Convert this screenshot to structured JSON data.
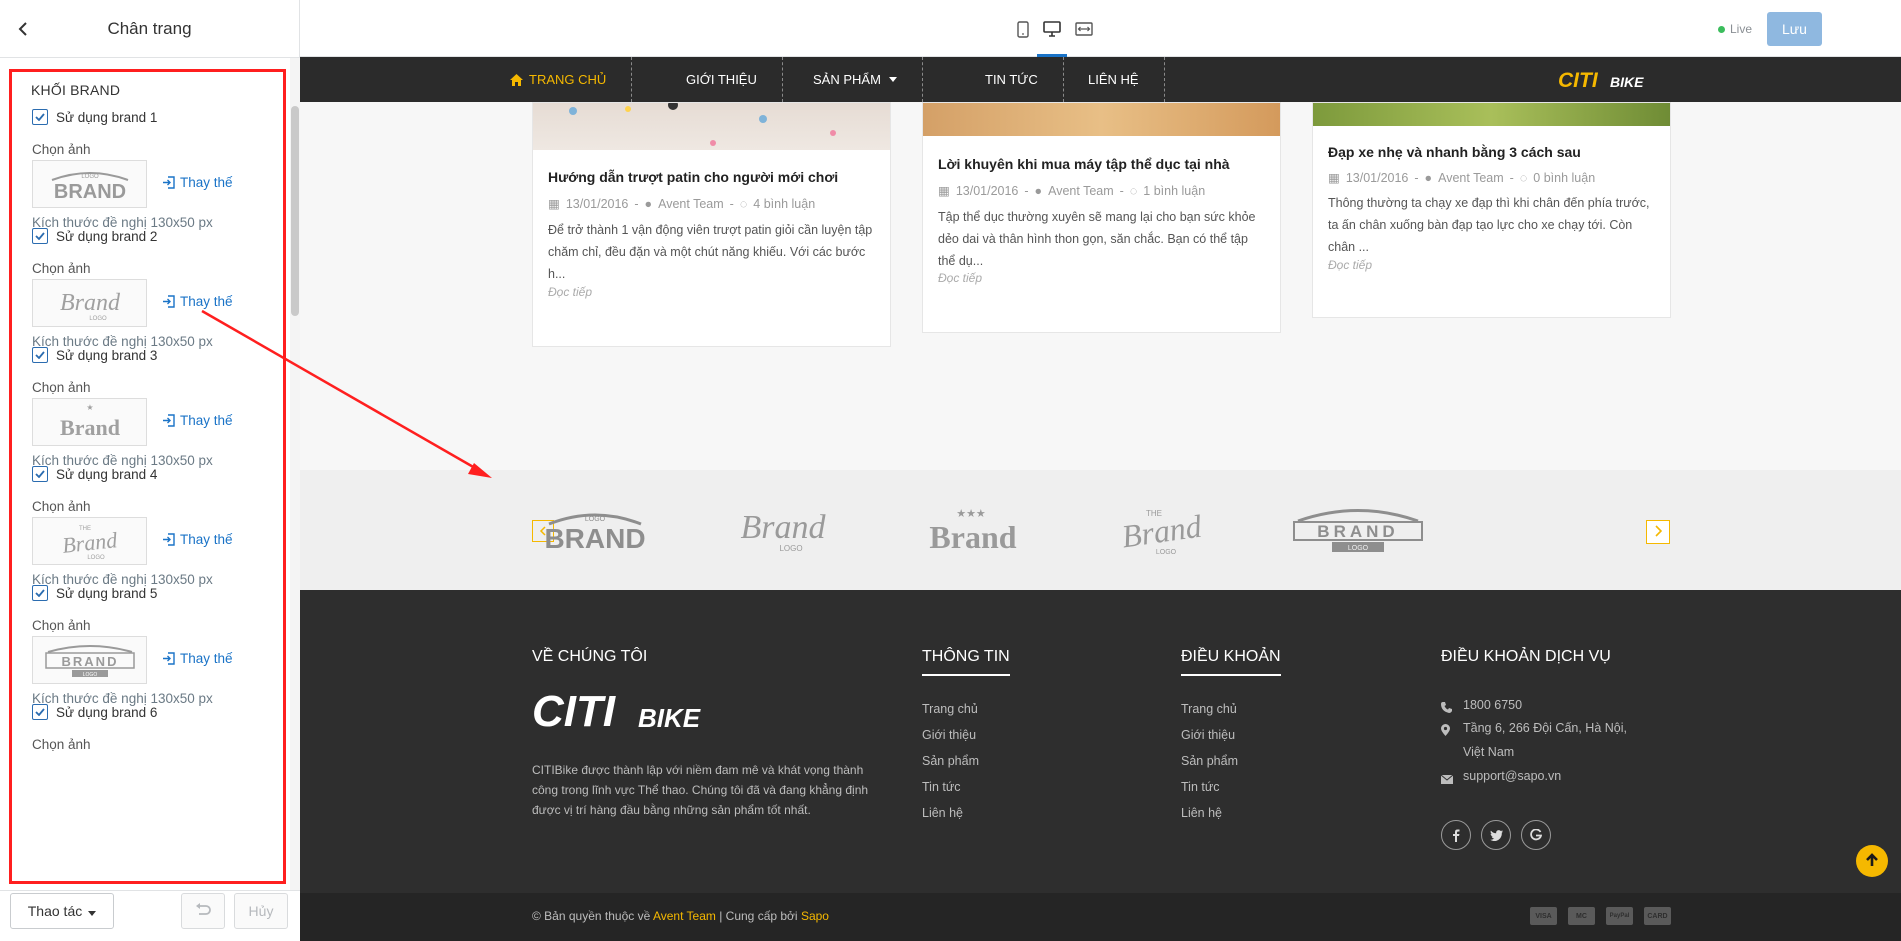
{
  "panel": {
    "title": "Chân trang",
    "block_title": "KHỐI BRAND",
    "brands": [
      {
        "use_label": "Sử dụng brand 1",
        "checked": true,
        "pick_label": "Chọn ảnh",
        "replace_label": "Thay thế",
        "size_hint": "Kích thước đề nghị 130x50 px",
        "thumb_text": "BRAND"
      },
      {
        "use_label": "Sử dụng brand 2",
        "checked": true,
        "pick_label": "Chọn ảnh",
        "replace_label": "Thay thế",
        "size_hint": "Kích thước đề nghị 130x50 px",
        "thumb_text": "Brand"
      },
      {
        "use_label": "Sử dụng brand 3",
        "checked": true,
        "pick_label": "Chọn ảnh",
        "replace_label": "Thay thế",
        "size_hint": "Kích thước đề nghị 130x50 px",
        "thumb_text": "Brand"
      },
      {
        "use_label": "Sử dụng brand 4",
        "checked": true,
        "pick_label": "Chọn ảnh",
        "replace_label": "Thay thế",
        "size_hint": "Kích thước đề nghị 130x50 px",
        "thumb_text": "Brand"
      },
      {
        "use_label": "Sử dụng brand 5",
        "checked": true,
        "pick_label": "Chọn ảnh",
        "replace_label": "Thay thế",
        "size_hint": "Kích thước đề nghị 130x50 px",
        "thumb_text": "BRAND"
      },
      {
        "use_label": "Sử dụng brand 6",
        "checked": true,
        "pick_label": "Chọn ảnh",
        "replace_label": "",
        "size_hint": "",
        "thumb_text": ""
      }
    ],
    "footer": {
      "actions_label": "Thao tác",
      "cancel_label": "Hủy"
    }
  },
  "topbar": {
    "live_label": "Live",
    "save_label": "Lưu",
    "active_device": "desktop"
  },
  "site": {
    "nav": [
      "TRANG CHỦ",
      "GIỚI THIỆU",
      "SẢN PHẨM",
      "TIN TỨC",
      "LIÊN HỆ"
    ],
    "logo_main": "CITI",
    "logo_sub": "BIKE",
    "articles": [
      {
        "title": "Hướng dẫn trượt patin cho người mới chơi",
        "date": "13/01/2016",
        "author": "Avent Team",
        "comments": "4 bình luận",
        "excerpt": "Để trở thành 1 vận động viên trượt patin giỏi cần luyện tập chăm chỉ, đều đặn và một chút năng khiếu. Với các bước h...",
        "more": "Đọc tiếp"
      },
      {
        "title": "Lời khuyên khi mua máy tập thể dục tại nhà",
        "date": "13/01/2016",
        "author": "Avent Team",
        "comments": "1 bình luận",
        "excerpt": "Tập thể dục thường xuyên sẽ mang lại cho bạn sức khỏe dẻo dai và thân hình thon gọn, săn chắc. Bạn có thể tập thể dụ...",
        "more": "Đọc tiếp"
      },
      {
        "title": "Đạp xe nhẹ và nhanh bằng 3 cách sau",
        "date": "13/01/2016",
        "author": "Avent Team",
        "comments": "0 bình luận",
        "excerpt": "Thông thường ta chạy xe đạp thì khi chân đến phía trước, ta ấn chân xuống bàn đạp tạo lực cho xe chạy tới. Còn chân ...",
        "more": "Đọc tiếp"
      }
    ],
    "brand_strip": [
      "BRAND",
      "Brand",
      "Brand",
      "Brand",
      "BRAND"
    ],
    "footer": {
      "about_title": "VỀ CHÚNG TÔI",
      "about_text": "CITIBike được thành lập với niềm đam mê và khát vọng thành công trong lĩnh vực Thể thao. Chúng tôi đã và đang khẳng định được vị trí hàng đầu bằng những sản phẩm tốt nhất.",
      "info_title": "THÔNG TIN",
      "info_links": [
        "Trang chủ",
        "Giới thiệu",
        "Sản phẩm",
        "Tin tức",
        "Liên hệ"
      ],
      "terms_title": "ĐIỀU KHOẢN",
      "terms_links": [
        "Trang chủ",
        "Giới thiệu",
        "Sản phẩm",
        "Tin tức",
        "Liên hệ"
      ],
      "service_title": "ĐIỀU KHOẢN DỊCH VỤ",
      "phone": "1800 6750",
      "address": "Tầng 6, 266 Đội Cấn, Hà Nội, Việt Nam",
      "email": "support@sapo.vn",
      "copyright_prefix": "© Bản quyền thuộc về",
      "copyright_owner": "Avent Team",
      "copyright_sep": "| Cung cấp bởi",
      "copyright_provider": "Sapo",
      "payments": [
        "VISA",
        "MC",
        "PayPal",
        "CARD"
      ]
    }
  },
  "colors": {
    "accent": "#f5b800",
    "highlight": "#ff1f1f",
    "link": "#1a73c7"
  }
}
